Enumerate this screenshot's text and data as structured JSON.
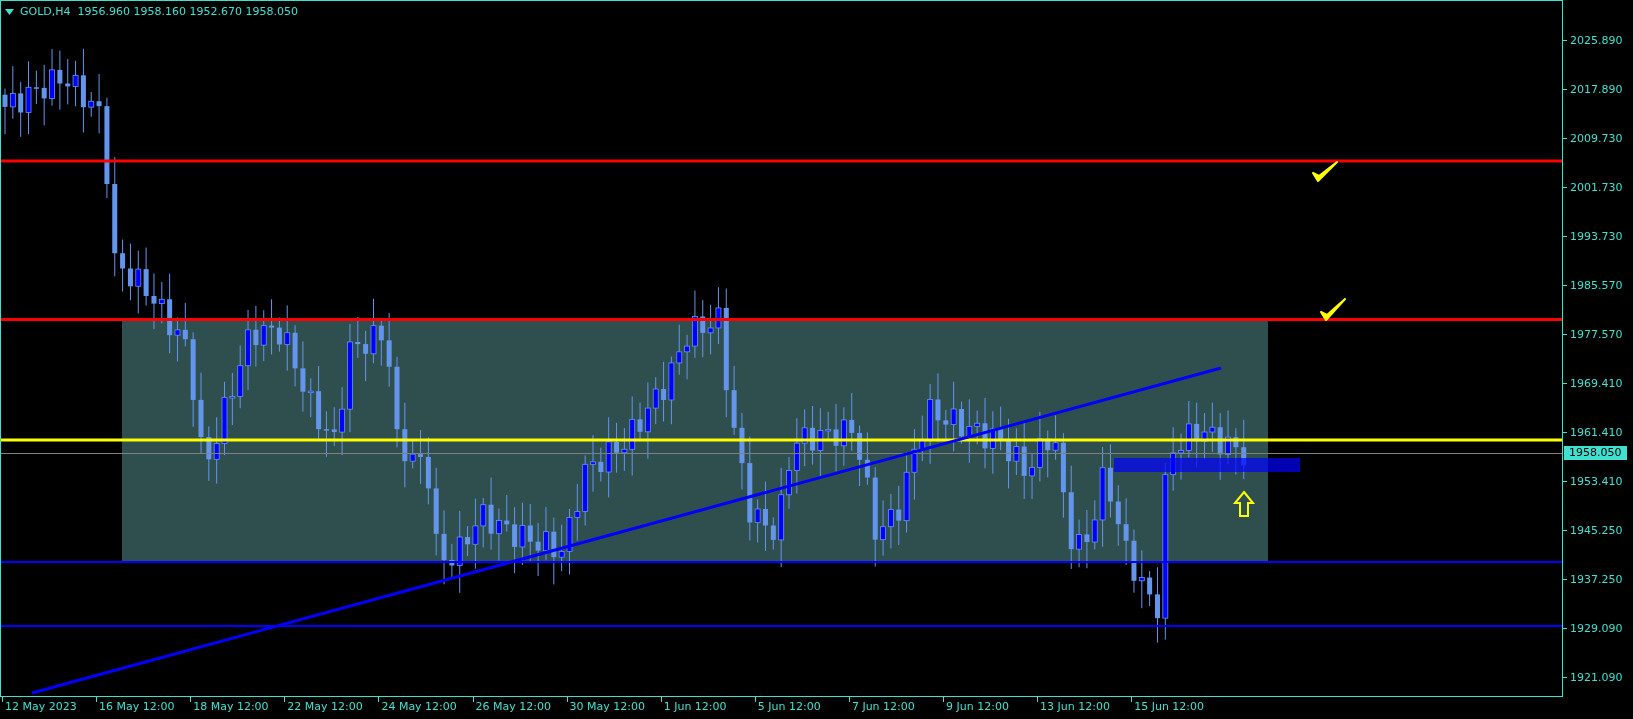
{
  "chart_header": {
    "symbol": "GOLD,H4",
    "open": "1956.960",
    "high": "1958.160",
    "low": "1952.670",
    "close": "1958.050"
  },
  "price_axis": {
    "labels": [
      "2025.890",
      "2017.890",
      "2009.730",
      "2001.730",
      "1993.730",
      "1985.570",
      "1977.570",
      "1969.410",
      "1961.410",
      "1953.410",
      "1945.250",
      "1937.250",
      "1929.090",
      "1921.090"
    ],
    "current_price": "1958.050"
  },
  "time_axis": {
    "labels": [
      "12 May 2023",
      "16 May 12:00",
      "18 May 12:00",
      "22 May 12:00",
      "24 May 12:00",
      "26 May 12:00",
      "30 May 12:00",
      "1 Jun 12:00",
      "5 Jun 12:00",
      "7 Jun 12:00",
      "9 Jun 12:00",
      "13 Jun 12:00",
      "15 Jun 12:00"
    ]
  }
}
